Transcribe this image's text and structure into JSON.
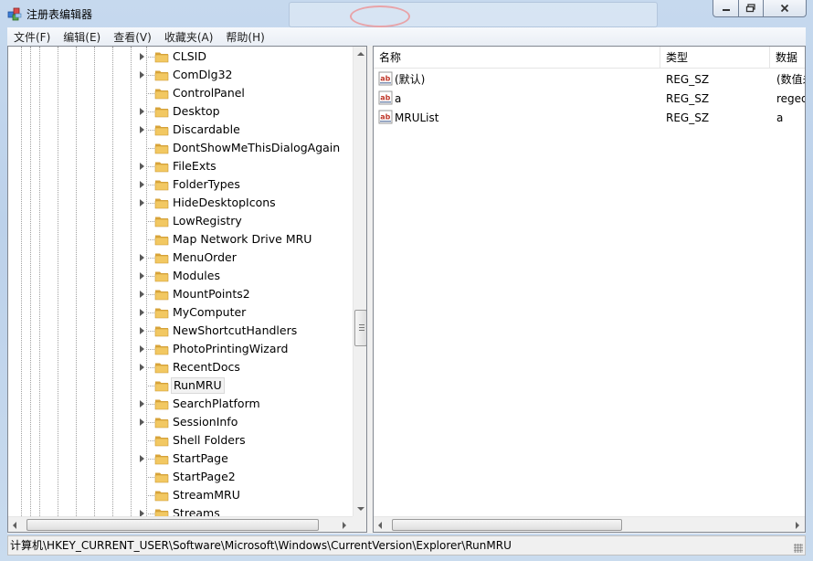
{
  "window": {
    "title": "注册表编辑器",
    "controls": {
      "minimize": "minimize-icon",
      "maximize": "maximize-icon",
      "close": "close-icon"
    }
  },
  "menu": [
    {
      "label": "文件(F)"
    },
    {
      "label": "编辑(E)"
    },
    {
      "label": "查看(V)"
    },
    {
      "label": "收藏夹(A)"
    },
    {
      "label": "帮助(H)"
    }
  ],
  "tree": {
    "selected": "RunMRU",
    "items": [
      {
        "label": "CLSID",
        "expandable": true
      },
      {
        "label": "ComDlg32",
        "expandable": true
      },
      {
        "label": "ControlPanel",
        "expandable": false
      },
      {
        "label": "Desktop",
        "expandable": true
      },
      {
        "label": "Discardable",
        "expandable": true
      },
      {
        "label": "DontShowMeThisDialogAgain",
        "expandable": false
      },
      {
        "label": "FileExts",
        "expandable": true
      },
      {
        "label": "FolderTypes",
        "expandable": true
      },
      {
        "label": "HideDesktopIcons",
        "expandable": true
      },
      {
        "label": "LowRegistry",
        "expandable": false
      },
      {
        "label": "Map Network Drive MRU",
        "expandable": false
      },
      {
        "label": "MenuOrder",
        "expandable": true
      },
      {
        "label": "Modules",
        "expandable": true
      },
      {
        "label": "MountPoints2",
        "expandable": true
      },
      {
        "label": "MyComputer",
        "expandable": true
      },
      {
        "label": "NewShortcutHandlers",
        "expandable": true
      },
      {
        "label": "PhotoPrintingWizard",
        "expandable": true
      },
      {
        "label": "RecentDocs",
        "expandable": true
      },
      {
        "label": "RunMRU",
        "expandable": false
      },
      {
        "label": "SearchPlatform",
        "expandable": true
      },
      {
        "label": "SessionInfo",
        "expandable": true
      },
      {
        "label": "Shell Folders",
        "expandable": false
      },
      {
        "label": "StartPage",
        "expandable": true
      },
      {
        "label": "StartPage2",
        "expandable": false
      },
      {
        "label": "StreamMRU",
        "expandable": false
      },
      {
        "label": "Streams",
        "expandable": true
      }
    ]
  },
  "list": {
    "columns": {
      "name": "名称",
      "type": "类型",
      "data": "数据"
    },
    "rows": [
      {
        "name": "(默认)",
        "type": "REG_SZ",
        "data": "(数值未设置)"
      },
      {
        "name": "a",
        "type": "REG_SZ",
        "data": "regedit"
      },
      {
        "name": "MRUList",
        "type": "REG_SZ",
        "data": "a"
      }
    ]
  },
  "statusbar": {
    "path": "计算机\\HKEY_CURRENT_USER\\Software\\Microsoft\\Windows\\CurrentVersion\\Explorer\\RunMRU"
  },
  "colors": {
    "chrome": "#c6d9ee",
    "folder": "#e8b84a",
    "value_icon": "#c0392b"
  }
}
